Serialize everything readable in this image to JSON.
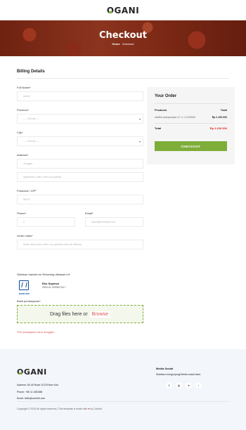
{
  "header": {
    "logo": "OGANI"
  },
  "hero": {
    "title": "Checkout",
    "breadcrumb_home": "Home",
    "breadcrumb_current": "Checkout"
  },
  "billing": {
    "title": "Billing Details",
    "fields": {
      "full_name": {
        "label": "Full Name*",
        "placeholder": "admin"
      },
      "province": {
        "label": "Province*",
        "value": "---- Choose ----"
      },
      "city": {
        "label": "City*",
        "value": "---- Choose ----"
      },
      "address": {
        "label": "Address*",
        "street_placeholder": "Jl.nagak",
        "apartment_placeholder": "Apartment, suite, unite ect (optinal)"
      },
      "postcode": {
        "label": "Postcode / ZIP*",
        "placeholder": "56470"
      },
      "phone": {
        "label": "Phone*",
        "placeholder": "0"
      },
      "email": {
        "label": "Email*",
        "placeholder": "admin@example.com"
      },
      "notes": {
        "label": "Order notes*",
        "placeholder": "Notes about your order, e.g. special notes for delivery."
      }
    },
    "bank": {
      "title": "Silahkan transfer ke Rekening dibawah ini*",
      "logo_text": "BANK BRI",
      "account_name": "Eko Sujarwo",
      "account_number": "0504-01-005952-50-7"
    },
    "proof": {
      "label": "Bukti pembayaran*",
      "drop_text": "Drag files here or",
      "browse_label": "Browse"
    },
    "error": "*File pembayaran harus diunggah."
  },
  "order": {
    "title": "Your Order",
    "col_products": "Products",
    "col_total": "Total",
    "items": [
      {
        "name": "sfsdfsd qweqweqwe x1 / 1 x 2100000",
        "price": "Rp 2.100.000"
      }
    ],
    "total_label": "Total",
    "total_value": "Rp 2.100.000",
    "button": "CHECKOUT"
  },
  "footer": {
    "logo": "OGANI",
    "address": "Address: 60-49 Road 11378 New York",
    "phone": "Phone: +65 11.188.888",
    "email": "Email: hello@colorlib.com",
    "media_title": "Media Sosial",
    "media_text": "Silahkan mengunjungi Media sosial kami",
    "socials": [
      {
        "icon": "facebook-icon",
        "glyph": "f"
      },
      {
        "icon": "instagram-icon",
        "glyph": "◎"
      },
      {
        "icon": "twitter-icon",
        "glyph": "♥"
      },
      {
        "icon": "tiktok-icon",
        "glyph": "♪"
      }
    ],
    "copyright_pre": "Copyright © 2024 All rights reserved | This template is made with",
    "copyright_post": "by Colorlib"
  },
  "colors": {
    "accent": "#7fad39",
    "price_red": "#dd2222",
    "bank_blue": "#0a4a9c"
  }
}
